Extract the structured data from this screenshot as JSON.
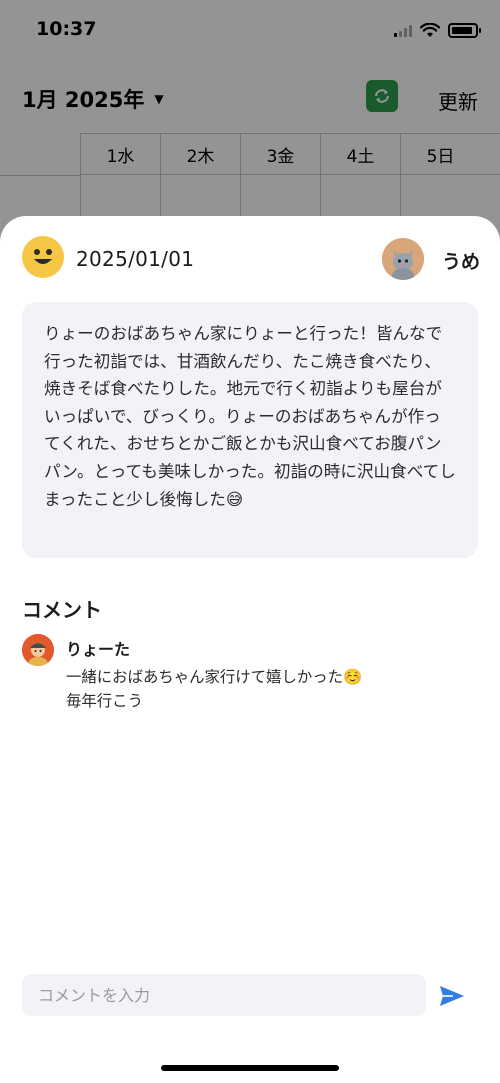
{
  "status_bar": {
    "time": "10:37"
  },
  "background_app": {
    "month_label": "1月 2025年",
    "refresh_label": "更新",
    "week_days": [
      "1水",
      "2木",
      "3金",
      "4土",
      "5日"
    ]
  },
  "sheet": {
    "date": "2025/01/01",
    "owner_name": "うめ",
    "diary_text": "りょーのおばあちゃん家にりょーと行った！皆んなで行った初詣では、甘酒飲んだり、たこ焼き食べたり、焼きそば食べたりした。地元で行く初詣よりも屋台がいっぱいで、びっくり。りょーのおばあちゃんが作ってくれた、おせちとかご飯とかも沢山食べてお腹パンパン。とっても美味しかった。初詣の時に沢山食べてしまったこと少し後悔した😅",
    "comments_title": "コメント",
    "comments": [
      {
        "name": "りょーた",
        "line1": "一緒におばあちゃん家行けて嬉しかった☺️",
        "line2": "毎年行こう"
      }
    ],
    "comment_input": {
      "placeholder": "コメントを入力",
      "value": ""
    }
  },
  "colors": {
    "accent": "#2f7de0",
    "calendar_icon": "#2e9e4f",
    "card_bg": "#f2f2f7",
    "author_face": "#f6c744"
  },
  "icons": {
    "author": "smiley-face-icon",
    "owner": "cat-avatar-icon",
    "commenter": "person-avatar-icon",
    "send": "send-arrow-icon",
    "calendar": "calendar-refresh-icon"
  }
}
